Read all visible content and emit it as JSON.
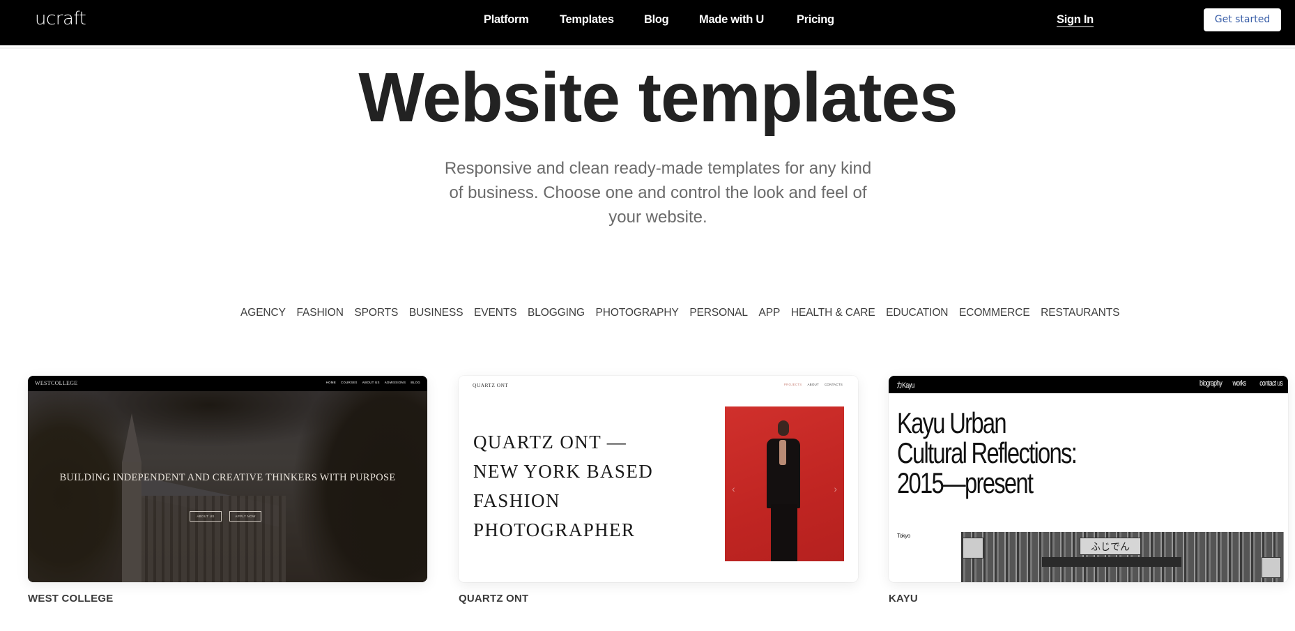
{
  "navbar": {
    "logo": "ucraft",
    "links": [
      "Platform",
      "Templates",
      "Blog",
      "Made with U",
      "Pricing"
    ],
    "sign_in": "Sign In",
    "get_started": "Get started",
    "colors": {
      "background": "#000000",
      "cta_text": "#3a5fa8"
    }
  },
  "hero": {
    "title": "Website templates",
    "subtitle": "Responsive and clean ready-made templates for any kind of business. Choose one and control the look and feel of your website."
  },
  "categories": [
    "AGENCY",
    "FASHION",
    "SPORTS",
    "BUSINESS",
    "EVENTS",
    "BLOGGING",
    "PHOTOGRAPHY",
    "PERSONAL",
    "APP",
    "HEALTH & CARE",
    "EDUCATION",
    "ECOMMERCE",
    "RESTAURANTS"
  ],
  "templates": [
    {
      "name": "WEST COLLEGE",
      "preview": {
        "logo": "WESTCOLLEGE",
        "menu": [
          "HOME",
          "COURSES",
          "ABOUT US",
          "ADMISSIONS",
          "BLOG"
        ],
        "headline": "BUILDING INDEPENDENT AND CREATIVE THINKERS WITH PURPOSE",
        "buttons": [
          "ABOUT US",
          "APPLY NOW"
        ]
      }
    },
    {
      "name": "QUARTZ ONT",
      "preview": {
        "logo": "QUARTZ ONT",
        "menu": [
          "PROJECTS",
          "ABOUT",
          "CONTACTS"
        ],
        "headline": "QUARTZ ONT —\nNEW YORK BASED\nFASHION\nPHOTOGRAPHER",
        "accent": "#c92624"
      }
    },
    {
      "name": "KAYU",
      "preview": {
        "logo": "カKayu",
        "menu": [
          "biography",
          "works",
          "contact us"
        ],
        "headline": "Kayu Urban\nCultural Reflections:\n2015—present",
        "caption": "Tokyo",
        "sign_text": "ふじでん"
      }
    }
  ]
}
